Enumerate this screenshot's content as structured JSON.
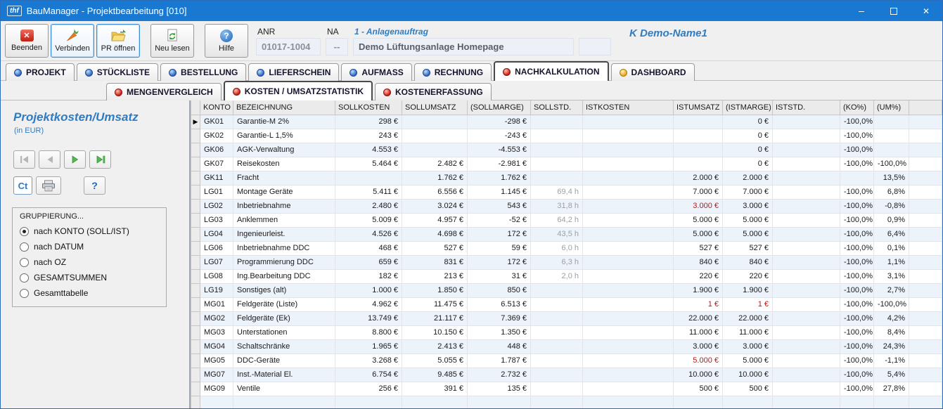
{
  "window": {
    "title": "BauManager - Projektbearbeitung [010]",
    "app_logo": "thf"
  },
  "toolbar": {
    "beenden": "Beenden",
    "verbinden": "Verbinden",
    "pr_oeffnen": "PR öffnen",
    "neu_lesen": "Neu lesen",
    "hilfe": "Hilfe"
  },
  "header_fields": {
    "anr_label": "ANR",
    "anr_value": "01017-1004",
    "na_label": "NA",
    "na_value": "--",
    "order_type": "1 - Anlagenauftrag",
    "project_title": "Demo Lüftungsanlage Homepage",
    "customer": "K Demo-Name1"
  },
  "main_tabs": [
    {
      "label": "PROJEKT",
      "dot": "blue",
      "active": false
    },
    {
      "label": "STÜCKLISTE",
      "dot": "blue",
      "active": false
    },
    {
      "label": "BESTELLUNG",
      "dot": "blue",
      "active": false
    },
    {
      "label": "LIEFERSCHEIN",
      "dot": "blue",
      "active": false
    },
    {
      "label": "AUFMASS",
      "dot": "blue",
      "active": false
    },
    {
      "label": "RECHNUNG",
      "dot": "blue",
      "active": false
    },
    {
      "label": "NACHKALKULATION",
      "dot": "red",
      "active": true
    },
    {
      "label": "DASHBOARD",
      "dot": "yellow",
      "active": false
    }
  ],
  "sub_tabs": [
    {
      "label": "MENGENVERGLEICH",
      "dot": "red",
      "active": false
    },
    {
      "label": "KOSTEN / UMSATZSTATISTIK",
      "dot": "red",
      "active": true
    },
    {
      "label": "KOSTENERFASSUNG",
      "dot": "red",
      "active": false
    }
  ],
  "sidebar": {
    "title": "Projektkosten/Umsatz",
    "subtitle": "(in EUR)",
    "ct_label": "Ct",
    "help_label": "?",
    "grouping": {
      "label": "GRUPPIERUNG...",
      "options": [
        {
          "label": "nach KONTO (SOLL/IST)",
          "selected": true
        },
        {
          "label": "nach DATUM",
          "selected": false
        },
        {
          "label": "nach OZ",
          "selected": false
        },
        {
          "label": "GESAMTSUMMEN",
          "selected": false
        },
        {
          "label": "Gesamttabelle",
          "selected": false
        }
      ]
    }
  },
  "colors": {
    "accent_blue": "#2e7cc3",
    "titlebar": "#1979d2",
    "negative_red": "#d01010"
  },
  "table": {
    "columns": [
      "KONTO",
      "BEZEICHNUNG",
      "SOLLKOSTEN",
      "SOLLUMSATZ",
      "(SOLLMARGE)",
      "SOLLSTD.",
      "ISTKOSTEN",
      "ISTUMSATZ",
      "(ISTMARGE)",
      "ISTSTD.",
      "(KO%)",
      "(UM%)"
    ],
    "col_keys": [
      "konto",
      "bezeichnung",
      "sollkosten",
      "sollumsatz",
      "sollmarge",
      "sollstd",
      "istkosten",
      "istumsatz",
      "istmarge",
      "iststd",
      "ko_pct",
      "um_pct"
    ],
    "selected_row": 0,
    "rows": [
      {
        "cells": [
          "GK01",
          "Garantie-M 2%",
          "298 €",
          "",
          "-298 €",
          "",
          "",
          "",
          "0 €",
          "",
          "-100,0%",
          ""
        ]
      },
      {
        "cells": [
          "GK02",
          "Garantie-L 1,5%",
          "243 €",
          "",
          "-243 €",
          "",
          "",
          "",
          "0 €",
          "",
          "-100,0%",
          ""
        ]
      },
      {
        "cells": [
          "GK06",
          "AGK-Verwaltung",
          "4.553 €",
          "",
          "-4.553 €",
          "",
          "",
          "",
          "0 €",
          "",
          "-100,0%",
          ""
        ]
      },
      {
        "cells": [
          "GK07",
          "Reisekosten",
          "5.464 €",
          "2.482 €",
          "-2.981 €",
          "",
          "",
          "",
          "0 €",
          "",
          "-100,0%",
          "-100,0%"
        ]
      },
      {
        "cells": [
          "GK11",
          "Fracht",
          "",
          "1.762 €",
          "1.762 €",
          "",
          "",
          "2.000 €",
          "2.000 €",
          "",
          "",
          "13,5%"
        ]
      },
      {
        "cells": [
          "LG01",
          "Montage Geräte",
          "5.411 €",
          "6.556 €",
          "1.145 €",
          "69,4 h",
          "",
          "7.000 €",
          "7.000 €",
          "",
          "-100,0%",
          "6,8%"
        ]
      },
      {
        "cells": [
          "LG02",
          "Inbetriebnahme",
          "2.480 €",
          "3.024 €",
          "543 €",
          "31,8 h",
          "",
          "3.000 €",
          "3.000 €",
          "",
          "-100,0%",
          "-0,8%"
        ],
        "red": [
          7
        ]
      },
      {
        "cells": [
          "LG03",
          "Anklemmen",
          "5.009 €",
          "4.957 €",
          "-52 €",
          "64,2 h",
          "",
          "5.000 €",
          "5.000 €",
          "",
          "-100,0%",
          "0,9%"
        ]
      },
      {
        "cells": [
          "LG04",
          "Ingenieurleist.",
          "4.526 €",
          "4.698 €",
          "172 €",
          "43,5 h",
          "",
          "5.000 €",
          "5.000 €",
          "",
          "-100,0%",
          "6,4%"
        ]
      },
      {
        "cells": [
          "LG06",
          "Inbetriebnahme DDC",
          "468 €",
          "527 €",
          "59 €",
          "6,0 h",
          "",
          "527 €",
          "527 €",
          "",
          "-100,0%",
          "0,1%"
        ]
      },
      {
        "cells": [
          "LG07",
          "Programmierung DDC",
          "659 €",
          "831 €",
          "172 €",
          "6,3 h",
          "",
          "840 €",
          "840 €",
          "",
          "-100,0%",
          "1,1%"
        ]
      },
      {
        "cells": [
          "LG08",
          "Ing.Bearbeitung DDC",
          "182 €",
          "213 €",
          "31 €",
          "2,0 h",
          "",
          "220 €",
          "220 €",
          "",
          "-100,0%",
          "3,1%"
        ]
      },
      {
        "cells": [
          "LG19",
          "Sonstiges (alt)",
          "1.000 €",
          "1.850 €",
          "850 €",
          "",
          "",
          "1.900 €",
          "1.900 €",
          "",
          "-100,0%",
          "2,7%"
        ]
      },
      {
        "cells": [
          "MG01",
          "Feldgeräte (Liste)",
          "4.962 €",
          "11.475 €",
          "6.513 €",
          "",
          "",
          "1 €",
          "1 €",
          "",
          "-100,0%",
          "-100,0%"
        ],
        "red": [
          7,
          8
        ]
      },
      {
        "cells": [
          "MG02",
          "Feldgeräte (Ek)",
          "13.749 €",
          "21.117 €",
          "7.369 €",
          "",
          "",
          "22.000 €",
          "22.000 €",
          "",
          "-100,0%",
          "4,2%"
        ]
      },
      {
        "cells": [
          "MG03",
          "Unterstationen",
          "8.800 €",
          "10.150 €",
          "1.350 €",
          "",
          "",
          "11.000 €",
          "11.000 €",
          "",
          "-100,0%",
          "8,4%"
        ]
      },
      {
        "cells": [
          "MG04",
          "Schaltschränke",
          "1.965 €",
          "2.413 €",
          "448 €",
          "",
          "",
          "3.000 €",
          "3.000 €",
          "",
          "-100,0%",
          "24,3%"
        ]
      },
      {
        "cells": [
          "MG05",
          "DDC-Geräte",
          "3.268 €",
          "5.055 €",
          "1.787 €",
          "",
          "",
          "5.000 €",
          "5.000 €",
          "",
          "-100,0%",
          "-1,1%"
        ],
        "red": [
          7
        ]
      },
      {
        "cells": [
          "MG07",
          "Inst.-Material El.",
          "6.754 €",
          "9.485 €",
          "2.732 €",
          "",
          "",
          "10.000 €",
          "10.000 €",
          "",
          "-100,0%",
          "5,4%"
        ]
      },
      {
        "cells": [
          "MG09",
          "Ventile",
          "256 €",
          "391 €",
          "135 €",
          "",
          "",
          "500 €",
          "500 €",
          "",
          "-100,0%",
          "27,8%"
        ]
      }
    ]
  }
}
